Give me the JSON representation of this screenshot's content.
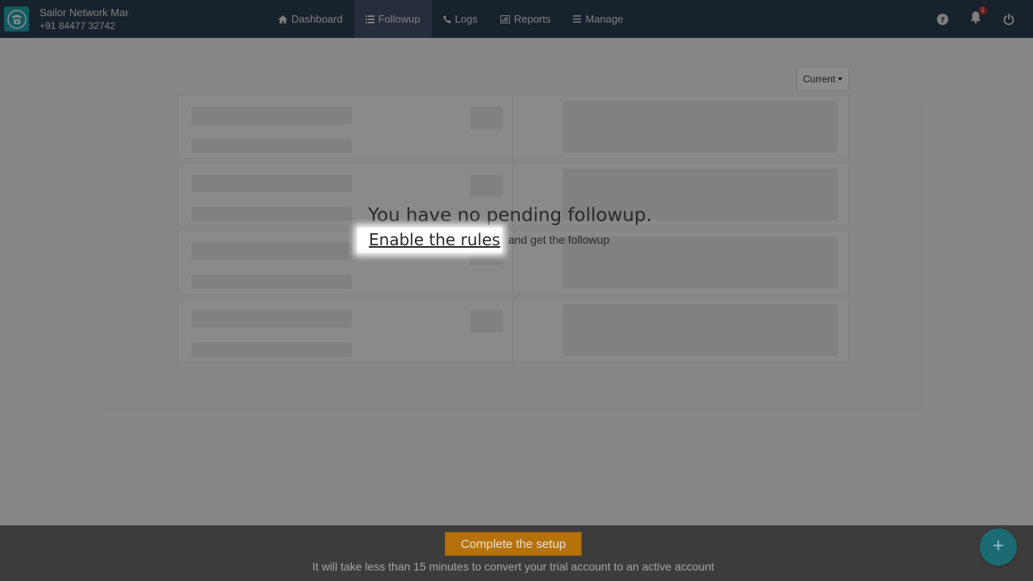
{
  "header": {
    "brand_name": "Sailor Network Mar",
    "brand_phone": "+91 84477 32742",
    "nav": [
      {
        "label": "Dashboard",
        "icon": "home-icon"
      },
      {
        "label": "Followup",
        "icon": "list-icon",
        "active": true
      },
      {
        "label": "Logs",
        "icon": "phone-icon"
      },
      {
        "label": "Reports",
        "icon": "bar-chart-icon"
      },
      {
        "label": "Manage",
        "icon": "menu-icon"
      }
    ],
    "notification_count": "1",
    "icons": [
      "help-icon",
      "bell-icon",
      "power-icon"
    ]
  },
  "main": {
    "filter_label": "Current",
    "empty_title": "You have no pending followup.",
    "enable_link": "Enable the rules",
    "enable_suffix": "and get the followup"
  },
  "footer": {
    "setup_button": "Complete the setup",
    "setup_note": "It will take less than 15 minutes to convert your trial account to an active account",
    "fab_icon": "plus-icon"
  },
  "colors": {
    "topbar": "#2d3e50",
    "accent": "#27a6b3",
    "setup_button": "#e8920a",
    "badge": "#c0392b"
  }
}
